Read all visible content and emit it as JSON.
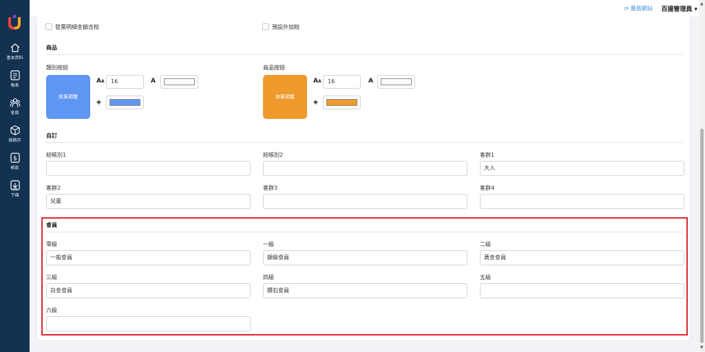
{
  "sidebar": {
    "items": [
      {
        "label": "基本資料",
        "icon": "home-icon"
      },
      {
        "label": "報表",
        "icon": "report-icon"
      },
      {
        "label": "會員",
        "icon": "members-icon"
      },
      {
        "label": "換銷存",
        "icon": "box-icon"
      },
      {
        "label": "帳款",
        "icon": "dollar-icon"
      },
      {
        "label": "下傳",
        "icon": "download-icon"
      }
    ]
  },
  "topbar": {
    "old_site": "舊版網站",
    "admin": "百揚管理員"
  },
  "options": {
    "invoice_tax": "發票明細金額含稅",
    "extra_tax": "預設外加稅"
  },
  "product": {
    "title": "商品",
    "category_button": {
      "label": "類別按鈕",
      "preview": "效果預覽",
      "font_size": "16",
      "fill_color": "#6096f3",
      "preview_color": "#6096f3"
    },
    "item_button": {
      "label": "商品按鈕",
      "preview": "效果預覽",
      "font_size": "16",
      "fill_color": "#f0992c",
      "preview_color": "#f0992c"
    }
  },
  "custom": {
    "title": "自訂",
    "fields": [
      {
        "label": "結帳別1",
        "value": ""
      },
      {
        "label": "結帳別2",
        "value": ""
      },
      {
        "label": "客群1",
        "value": "大人"
      },
      {
        "label": "客群2",
        "value": "兒童"
      },
      {
        "label": "客群3",
        "value": ""
      },
      {
        "label": "客群4",
        "value": ""
      }
    ]
  },
  "member": {
    "title": "會員",
    "fields": [
      {
        "label": "零級",
        "value": "一般會員"
      },
      {
        "label": "一級",
        "value": "銀級會員"
      },
      {
        "label": "二級",
        "value": "黃金會員"
      },
      {
        "label": "三級",
        "value": "白金會員"
      },
      {
        "label": "四級",
        "value": "鑽石會員"
      },
      {
        "label": "五級",
        "value": ""
      },
      {
        "label": "六級",
        "value": ""
      }
    ]
  }
}
